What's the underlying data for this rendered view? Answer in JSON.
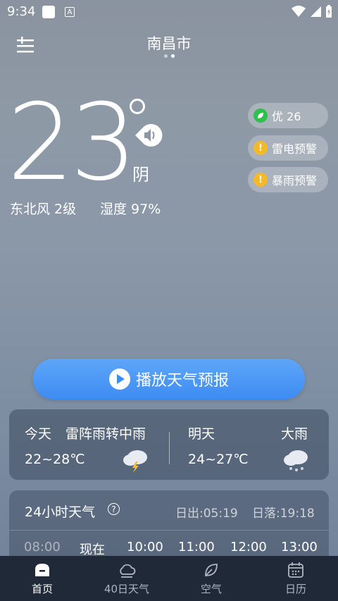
{
  "status": {
    "time": "9:34",
    "app_icon_letter": "A"
  },
  "header": {
    "city": "南昌市"
  },
  "current": {
    "temperature": "23",
    "condition": "阴",
    "wind": "东北风 2级",
    "humidity": "湿度 97%"
  },
  "badges": [
    {
      "label": "优 26",
      "color": "#2fbf4b",
      "icon": "leaf-icon"
    },
    {
      "label": "雷电预警",
      "color": "#f4b92b",
      "icon": "warning-icon"
    },
    {
      "label": "暴雨预警",
      "color": "#f4b92b",
      "icon": "warning-icon"
    }
  ],
  "play_button": {
    "label": "播放天气预报"
  },
  "forecast": {
    "today": {
      "label": "今天",
      "condition": "雷阵雨转中雨",
      "range": "22~28℃"
    },
    "tomorrow": {
      "label": "明天",
      "condition": "大雨",
      "range": "24~27℃"
    }
  },
  "hourly": {
    "title": "24小时天气",
    "sunrise": "日出:05:19",
    "sunset": "日落:19:18",
    "hours": [
      "08:00",
      "现在",
      "10:00",
      "11:00",
      "12:00",
      "13:00"
    ]
  },
  "nav": [
    {
      "label": "首页",
      "icon": "home-icon",
      "active": true
    },
    {
      "label": "40日天气",
      "icon": "cloud-icon",
      "active": false
    },
    {
      "label": "空气",
      "icon": "leaf-icon",
      "active": false
    },
    {
      "label": "日历",
      "icon": "calendar-icon",
      "active": false
    }
  ]
}
